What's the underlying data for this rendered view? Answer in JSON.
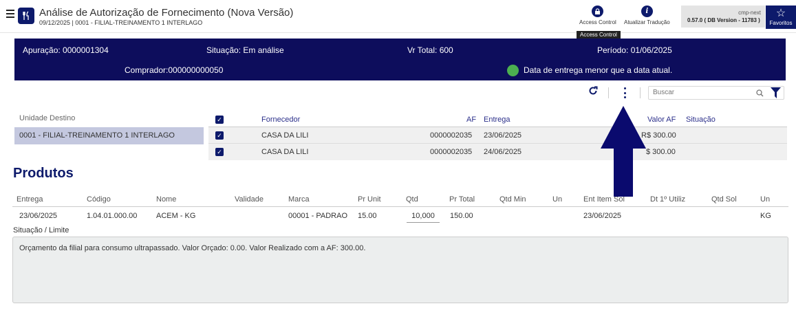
{
  "header": {
    "title": "Análise de Autorização de Fornecimento (Nova Versão)",
    "subtitle": "09/12/2025 | 0001 - FILIAL-TREINAMENTO 1 INTERLAGO",
    "actions": [
      {
        "label": "Access Control",
        "icon": "lock-icon"
      },
      {
        "label": "Atualizar Tradução",
        "icon": "info-icon"
      }
    ],
    "tooltip": "Access Control",
    "env": "cmp-next",
    "version": "0.57.0 ( DB Version - 11783 )",
    "favorites_label": "Favoritos"
  },
  "summary": {
    "apuracao": "Apuração: 0000001304",
    "situacao": "Situação: Em análise",
    "vr_total": "Vr Total: 600",
    "periodo": "Período: 01/06/2025",
    "comprador": "Comprador:000000000050",
    "status_message": "Data de entrega menor que a data atual.",
    "status_color": "#4caf50"
  },
  "toolbar": {
    "search_placeholder": "Buscar"
  },
  "unidade": {
    "header": "Unidade Destino",
    "items": [
      "0001 - FILIAL-TREINAMENTO 1 INTERLAGO"
    ]
  },
  "fornecedores": {
    "columns": {
      "fornecedor": "Fornecedor",
      "af": "AF",
      "entrega": "Entrega",
      "valor_af": "Valor AF",
      "situacao": "Situação"
    },
    "rows": [
      {
        "fornecedor": "CASA DA LILI",
        "af": "0000002035",
        "entrega": "23/06/2025",
        "valor_af": "R$ 300.00",
        "situacao": ""
      },
      {
        "fornecedor": "CASA DA LILI",
        "af": "0000002035",
        "entrega": "24/06/2025",
        "valor_af": "$ 300.00",
        "situacao": ""
      }
    ]
  },
  "produtos": {
    "title": "Produtos",
    "columns": [
      "Entrega",
      "Código",
      "Nome",
      "Validade",
      "Marca",
      "Pr Unit",
      "Qtd",
      "Pr Total",
      "Qtd Min",
      "Un",
      "Ent Item Sol",
      "Dt 1º Utiliz",
      "Qtd Sol",
      "Un"
    ],
    "row": {
      "entrega": "23/06/2025",
      "codigo": "1.04.01.000.00",
      "nome": "ACEM - KG",
      "validade": "",
      "marca": "00001 - PADRAO",
      "pr_unit": "15.00",
      "qtd": "10,000",
      "pr_total": "150.00",
      "qtd_min": "",
      "un": "",
      "ent_item_sol": "23/06/2025",
      "dt_utiliz": "",
      "qtd_sol": "",
      "un2": "KG"
    },
    "situacao_label": "Situação / Limite",
    "situacao_text": "Orçamento da filial para consumo ultrapassado. Valor Orçado: 0.00. Valor Realizado com a AF: 300.00."
  },
  "colors": {
    "brand": "#0d1a6b",
    "panel": "#0d0d5c",
    "selected_row": "#c4c8df"
  }
}
